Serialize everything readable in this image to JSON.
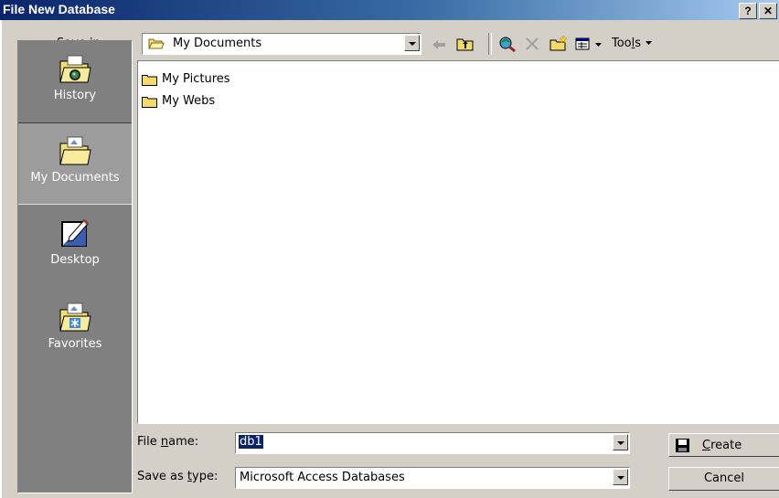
{
  "window": {
    "title": "File New Database",
    "help_label": "?",
    "close_label": "✕"
  },
  "toolbar": {
    "save_in_label_pre": "Save ",
    "save_in_label_key": "i",
    "save_in_label_post": "n:",
    "location": "My Documents",
    "tools_pre": "Too",
    "tools_key": "l",
    "tools_post": "s"
  },
  "places": [
    {
      "label": "History",
      "icon": "history-icon"
    },
    {
      "label": "My Documents",
      "icon": "my-documents-icon"
    },
    {
      "label": "Desktop",
      "icon": "desktop-icon"
    },
    {
      "label": "Favorites",
      "icon": "favorites-icon"
    }
  ],
  "files": [
    {
      "name": "My Pictures",
      "icon": "folder-icon"
    },
    {
      "name": "My Webs",
      "icon": "folder-icon"
    }
  ],
  "form": {
    "filename_pre": "File ",
    "filename_key": "n",
    "filename_post": "ame:",
    "filename_value": "db1",
    "savetype_pre": "Save as ",
    "savetype_key": "t",
    "savetype_post": "ype:",
    "savetype_value": "Microsoft Access Databases"
  },
  "buttons": {
    "create_key": "C",
    "create_rest": "reate",
    "cancel": "Cancel"
  },
  "colors": {
    "title_bar": "#0a246a",
    "dialog_face": "#d4d0c8",
    "places_bar": "#808080",
    "selection": "#0a246a"
  }
}
